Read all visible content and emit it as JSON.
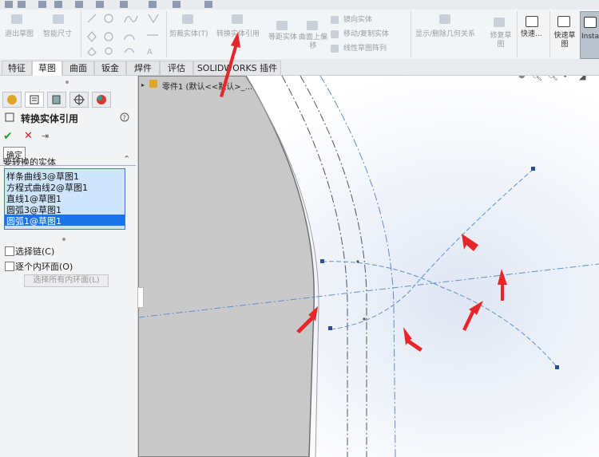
{
  "toolbar": {
    "exit_sketch": "退出草图",
    "smart_dimension": "智能尺寸",
    "trim_entities": "剪裁实体(T)",
    "convert_entities": "转换实体引用",
    "offset_entities": "等距实体",
    "offset_on_surface": "曲面上偏移",
    "mirror_entities": "镜向实体",
    "move_copy_entities": "移动/复制实体",
    "linear_pattern": "线性草图阵列",
    "display_delete_relations": "显示/删除几何关系",
    "repair_sketch": "修复草图",
    "quick_snaps": "快速...",
    "rapid_sketch": "快速草图",
    "instant2d": "Insta"
  },
  "tabs": [
    {
      "label": "特征",
      "active": false
    },
    {
      "label": "草图",
      "active": true
    },
    {
      "label": "曲面",
      "active": false
    },
    {
      "label": "钣金",
      "active": false
    },
    {
      "label": "焊件",
      "active": false
    },
    {
      "label": "评估",
      "active": false
    },
    {
      "label": "SOLIDWORKS 插件",
      "active": false
    }
  ],
  "tree": {
    "part_label": "零件1  (默认<<默认>_..."
  },
  "property_manager": {
    "title": "转换实体引用",
    "ok_tooltip": "确定",
    "section_title": "要转换的实体",
    "entities": [
      {
        "label": "样条曲线3@草图1",
        "selected": false
      },
      {
        "label": "方程式曲线2@草图1",
        "selected": false
      },
      {
        "label": "直线1@草图1",
        "selected": false
      },
      {
        "label": "圆弧3@草图1",
        "selected": false
      },
      {
        "label": "圆弧1@草图1",
        "selected": true
      }
    ],
    "select_chain": "选择链(C)",
    "each_inner_loop": "逐个内环面(O)",
    "select_all_inner_loops": "选择所有内环面(L)"
  },
  "colors": {
    "accent": "#1f6fc0",
    "annotation_arrow": "#e8262a",
    "sketch_line": "#5b8fcf",
    "selection_bg": "#cde4fb",
    "selected_row_bg": "#1a73e8",
    "model_face": "#c8c8c8"
  }
}
